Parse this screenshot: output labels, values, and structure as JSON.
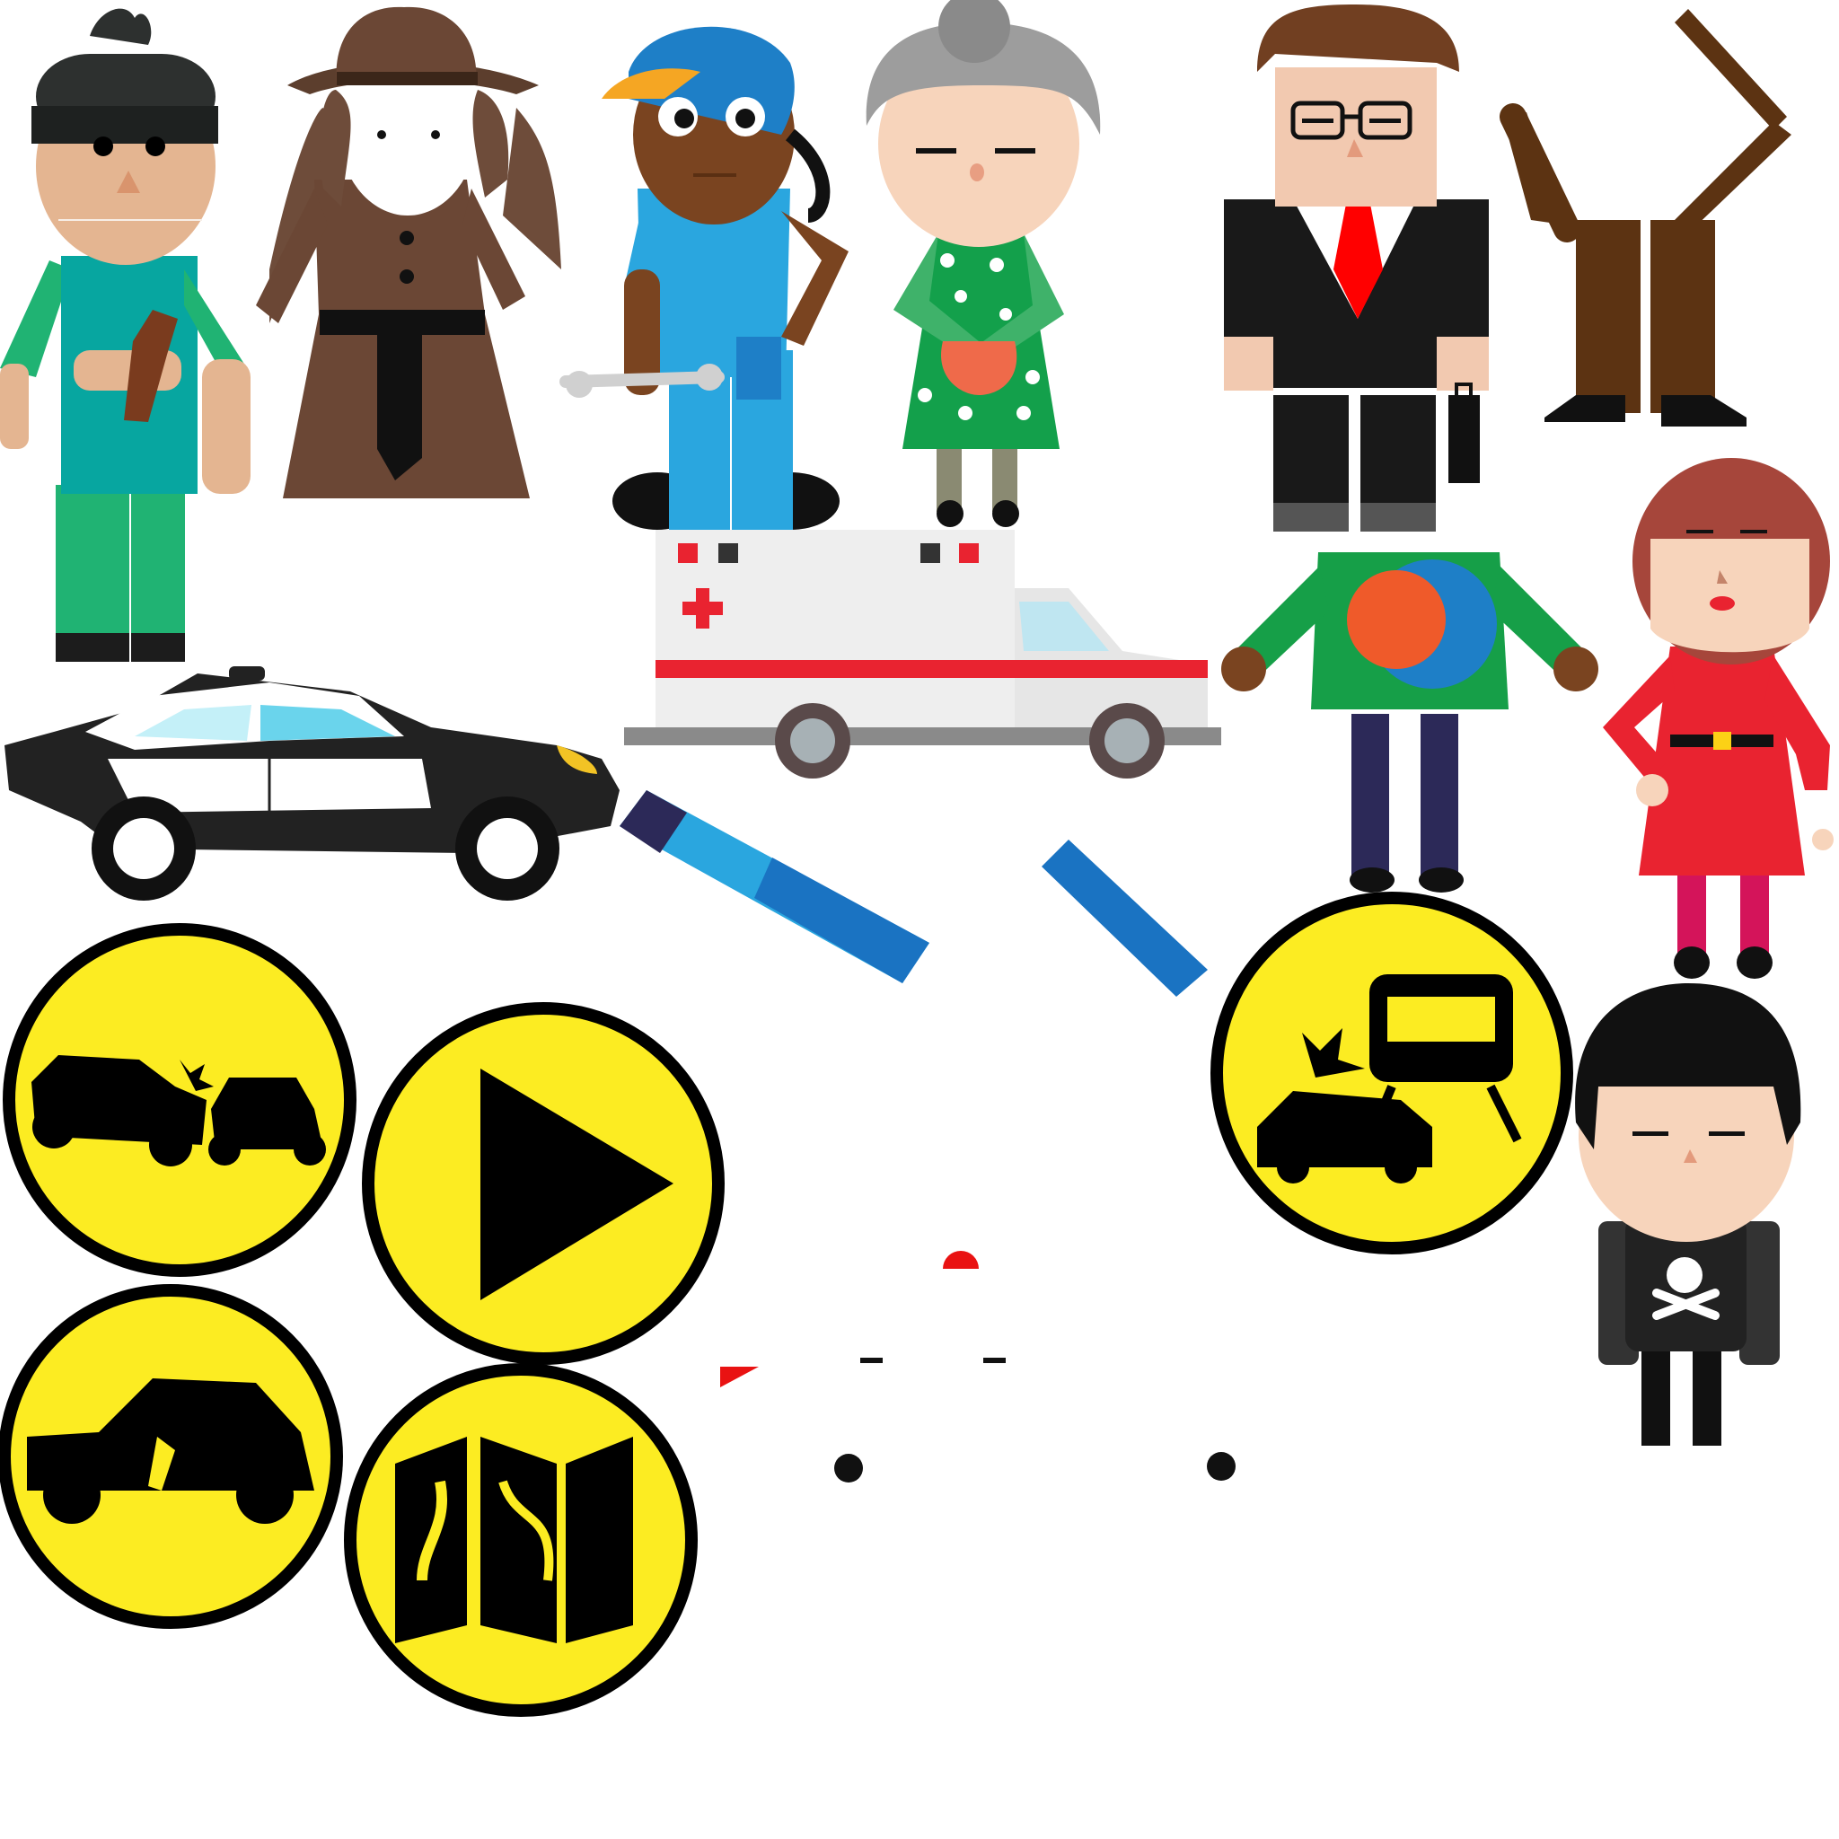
{
  "sheet": {
    "sprites": [
      {
        "name": "drunk-man-sprite",
        "icon": "man-with-bottle-icon"
      },
      {
        "name": "detective-sprite",
        "icon": "trench-coat-detective-icon"
      },
      {
        "name": "mechanic-sprite",
        "icon": "mechanic-with-wrench-icon"
      },
      {
        "name": "grandmother-sprite",
        "icon": "grandmother-with-purse-icon"
      },
      {
        "name": "businessman-sprite",
        "icon": "businessman-with-briefcase-icon"
      },
      {
        "name": "legs-arms-sprite",
        "icon": "limbs-icon"
      },
      {
        "name": "police-car-sprite",
        "icon": "police-car-icon"
      },
      {
        "name": "ambulance-sprite",
        "icon": "ambulance-icon"
      },
      {
        "name": "green-shirt-man-sprite",
        "icon": "green-shirt-man-icon"
      },
      {
        "name": "red-dress-woman-sprite",
        "icon": "red-dress-woman-icon"
      },
      {
        "name": "goth-kid-sprite",
        "icon": "skull-shirt-kid-icon"
      }
    ],
    "buttons": [
      {
        "name": "car-crash-button",
        "icon": "car-crash-icon"
      },
      {
        "name": "play-button",
        "icon": "play-icon"
      },
      {
        "name": "train-crash-button",
        "icon": "train-car-crash-icon"
      },
      {
        "name": "drunk-driving-button",
        "icon": "car-bottle-icon"
      },
      {
        "name": "map-button",
        "icon": "folded-map-icon"
      }
    ],
    "faint_text": {
      "line1": "",
      "line2": ""
    }
  },
  "colors": {
    "sign_yellow": "#fcec22",
    "sign_border": "#000000",
    "ambulance_red": "#e92330",
    "police_black": "#222222",
    "baton_blue": "#2aa6df"
  }
}
